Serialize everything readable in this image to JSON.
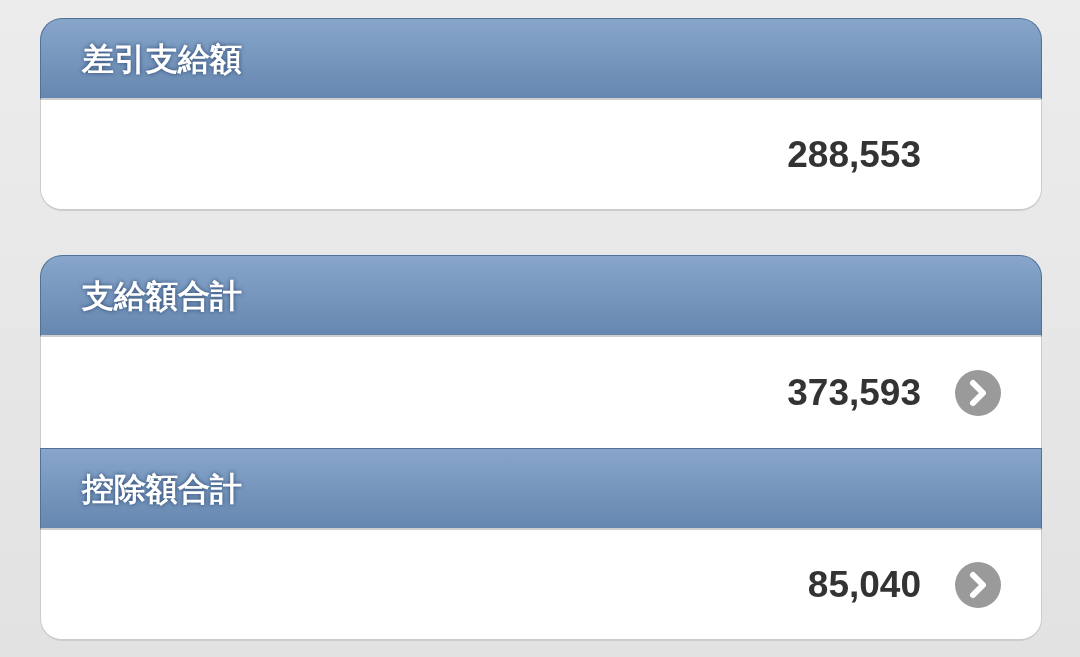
{
  "sections": [
    {
      "rows": [
        {
          "title": "差引支給額",
          "amount": "288,553",
          "kind": "plain"
        }
      ]
    },
    {
      "rows": [
        {
          "title": "支給額合計",
          "amount": "373,593",
          "kind": "link"
        },
        {
          "title": "控除額合計",
          "amount": "85,040",
          "kind": "link"
        }
      ]
    }
  ]
}
